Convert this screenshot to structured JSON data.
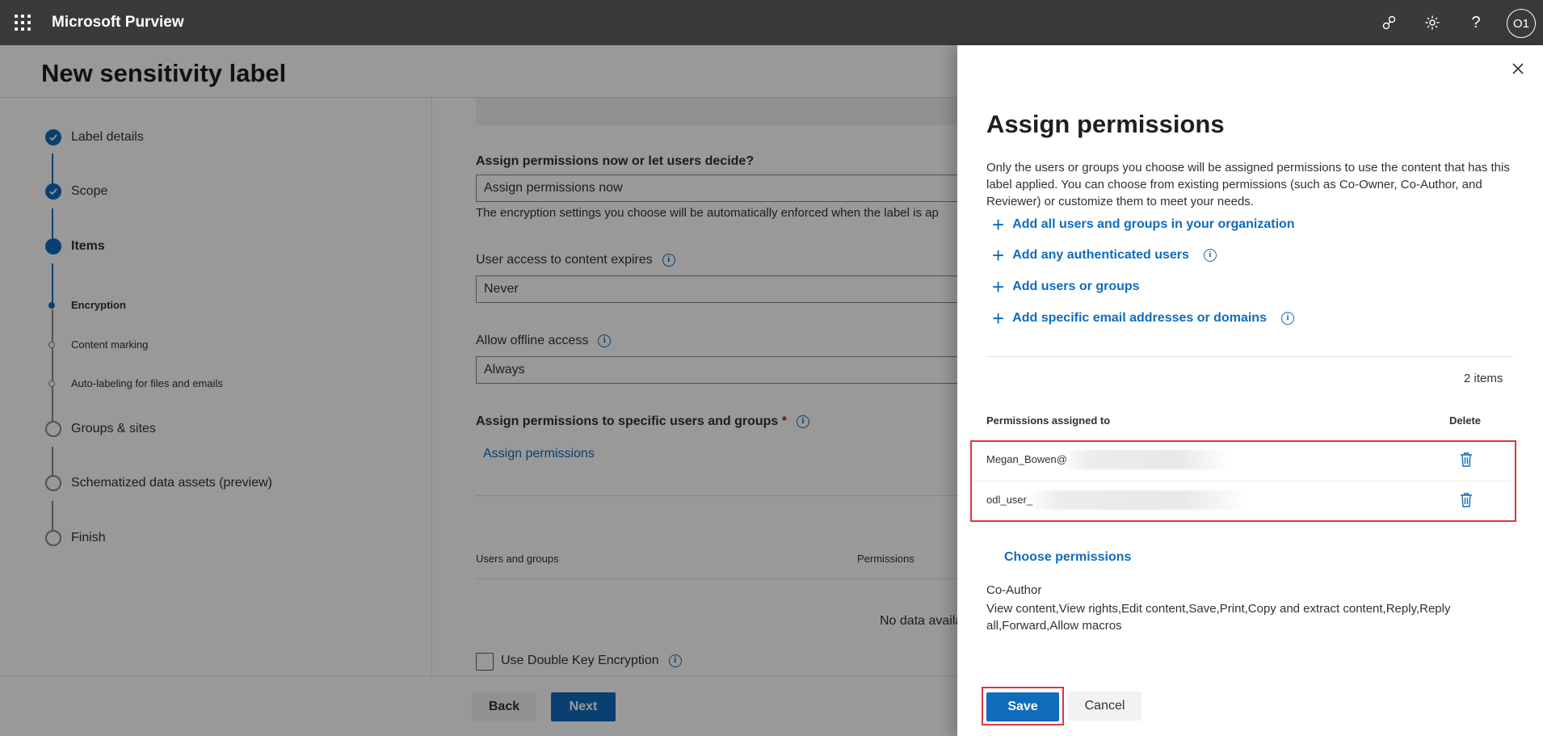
{
  "topbar": {
    "app_name": "Microsoft Purview",
    "icons": [
      "waffle-icon",
      "feedback-icon",
      "settings-icon",
      "help-icon"
    ],
    "avatar_initials": "O1"
  },
  "page": {
    "title": "New sensitivity label",
    "steps": [
      {
        "label": "Label details",
        "state": "done"
      },
      {
        "label": "Scope",
        "state": "done"
      },
      {
        "label": "Items",
        "state": "current"
      },
      {
        "label": "Groups & sites",
        "state": "future"
      },
      {
        "label": "Schematized data assets (preview)",
        "state": "future"
      },
      {
        "label": "Finish",
        "state": "future"
      }
    ],
    "substeps": [
      {
        "label": "Encryption",
        "state": "current"
      },
      {
        "label": "Content marking",
        "state": "future"
      },
      {
        "label": "Auto-labeling for files and emails",
        "state": "future"
      }
    ],
    "assign_now_label": "Assign permissions now or let users decide?",
    "assign_now_value": "Assign permissions now",
    "assign_now_helper": "The encryption settings you choose will be automatically enforced when the label is ap",
    "expires_label": "User access to content expires",
    "expires_value": "Never",
    "offline_label": "Allow offline access",
    "offline_value": "Always",
    "specific_label": "Assign permissions to specific users and groups",
    "required_marker": "*",
    "assign_link": "Assign permissions",
    "table_col_users": "Users and groups",
    "table_col_permissions": "Permissions",
    "no_data": "No data availa",
    "dke_label": "Use Double Key Encryption",
    "back_label": "Back",
    "next_label": "Next"
  },
  "panel": {
    "title": "Assign permissions",
    "description": "Only the users or groups you choose will be assigned permissions to use the content that has this label applied. You can choose from existing permissions (such as Co-Owner, Co-Author, and Reviewer) or customize them to meet your needs.",
    "add_links": [
      {
        "label": "Add all users and groups in your organization",
        "info": false
      },
      {
        "label": "Add any authenticated users",
        "info": true
      },
      {
        "label": "Add users or groups",
        "info": false
      },
      {
        "label": "Add specific email addresses or domains",
        "info": true
      }
    ],
    "items_count": "2 items",
    "col_assigned": "Permissions assigned to",
    "col_delete": "Delete",
    "rows": [
      {
        "name": "Megan_Bowen@"
      },
      {
        "name": "odl_user_"
      }
    ],
    "choose_link": "Choose permissions",
    "role": "Co-Author",
    "rights": "View content,View rights,Edit content,Save,Print,Copy and extract content,Reply,Reply all,Forward,Allow macros",
    "save_label": "Save",
    "cancel_label": "Cancel"
  },
  "colors": {
    "accent": "#0f6cbd",
    "topbar": "#3b3a39",
    "highlight": "#e0353c"
  }
}
